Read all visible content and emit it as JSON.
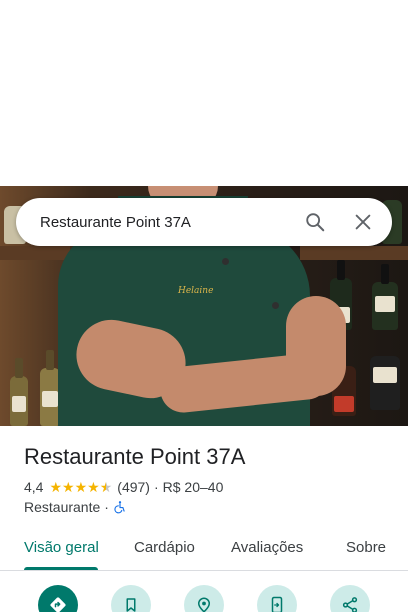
{
  "search": {
    "query": "Restaurante Point 37A"
  },
  "place": {
    "name": "Restaurante Point 37A",
    "rating": "4,4",
    "rating_value": 4.4,
    "reviews": "(497)",
    "separator": "·",
    "price": "R$ 20–40",
    "category": "Restaurante",
    "category_separator": "·",
    "photo_embroidery": "Helaine"
  },
  "tabs": [
    {
      "label": "Visão geral",
      "active": true
    },
    {
      "label": "Cardápio",
      "active": false
    },
    {
      "label": "Avaliações",
      "active": false
    },
    {
      "label": "Sobre",
      "active": false
    }
  ],
  "actions": [
    {
      "icon": "directions-icon",
      "primary": true
    },
    {
      "icon": "bookmark-icon",
      "primary": false
    },
    {
      "icon": "nearby-icon",
      "primary": false
    },
    {
      "icon": "send-to-phone-icon",
      "primary": false
    },
    {
      "icon": "share-icon",
      "primary": false
    }
  ],
  "colors": {
    "accent": "#00796b",
    "accent_light": "#cdebe8",
    "star": "#f5b400",
    "accessibility": "#1a73e8"
  }
}
